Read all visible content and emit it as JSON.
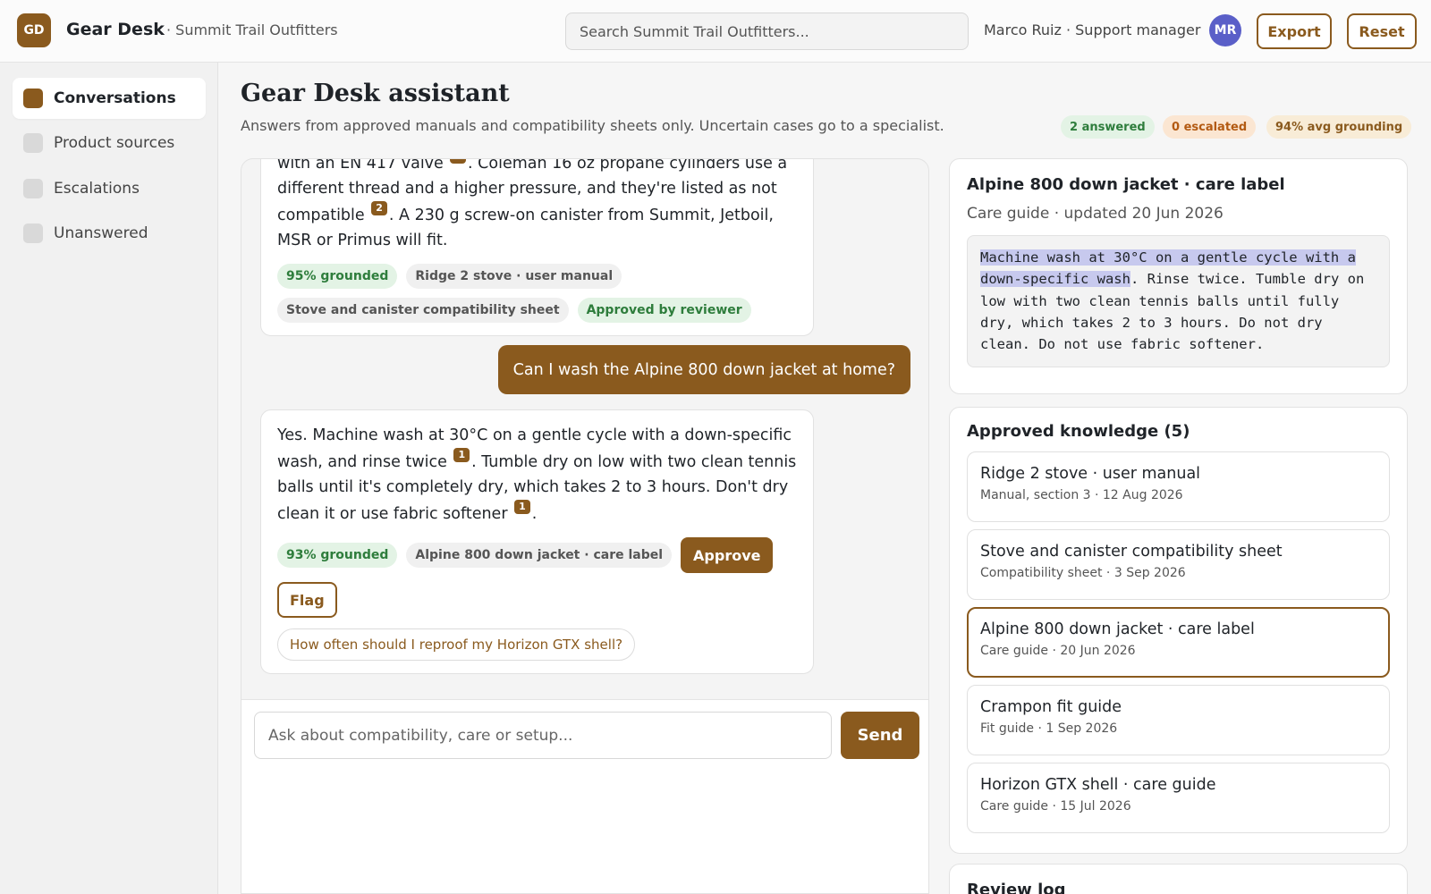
{
  "app": {
    "logo": "GD",
    "name": "Gear Desk",
    "org": "· Summit Trail Outfitters"
  },
  "topbar": {
    "search_placeholder": "Search Summit Trail Outfitters...",
    "user": "Marco Ruiz · Support manager",
    "avatar": "MR",
    "export_label": "Export",
    "reset_label": "Reset"
  },
  "sidebar": {
    "items": [
      {
        "label": "Conversations",
        "active": true
      },
      {
        "label": "Product sources"
      },
      {
        "label": "Escalations"
      },
      {
        "label": "Unanswered"
      }
    ]
  },
  "header": {
    "title": "Gear Desk assistant",
    "subtitle": "Answers from approved manuals and compatibility sheets only. Uncertain cases go to a specialist.",
    "badges": {
      "answered": "2 answered",
      "escalated": "0 escalated",
      "grounding": "94% avg grounding"
    }
  },
  "chat": {
    "prev_answer": {
      "line0": "with an EN 417 valve",
      "line1": ". Coleman 16 oz propane cylinders use a different thread and a higher pressure, and they're listed as not compatible",
      "cite_a": "1",
      "cite_b": "2",
      "line2": ". A 230 g screw-on canister from Summit, Jetboil, MSR or Primus will fit.",
      "grounded": "95% grounded",
      "source1": "Ridge 2 stove · user manual",
      "source2": "Stove and canister compatibility sheet",
      "approved": "Approved by reviewer"
    },
    "user_question": "Can I wash the Alpine 800 down jacket at home?",
    "answer": {
      "part1": "Yes. Machine wash at 30°C on a gentle cycle with a down-specific wash, and rinse twice",
      "cite1": "1",
      "part2": ". Tumble dry on low with two clean tennis balls until it's completely dry, which takes 2 to 3 hours. Don't dry clean it or use fabric softener",
      "cite2": "1",
      "part3": ".",
      "grounded": "93% grounded",
      "source": "Alpine 800 down jacket · care label",
      "approve_label": "Approve",
      "flag_label": "Flag",
      "suggestion": "How often should I reproof my Horizon GTX shell?"
    },
    "composer": {
      "placeholder": "Ask about compatibility, care or setup...",
      "send_label": "Send"
    }
  },
  "source_view": {
    "title": "Alpine 800 down jacket · care label",
    "meta": "Care guide · updated 20 Jun 2026",
    "highlight": "Machine wash at 30°C on a gentle cycle with a down-specific wash",
    "rest": ". Rinse twice. Tumble dry on low with two clean tennis balls until fully dry, which takes 2 to 3 hours. Do not dry clean. Do not use fabric softener."
  },
  "knowledge": {
    "title": "Approved knowledge (5)",
    "items": [
      {
        "name": "Ridge 2 stove · user manual",
        "meta": "Manual, section 3 · 12 Aug 2026"
      },
      {
        "name": "Stove and canister compatibility sheet",
        "meta": "Compatibility sheet · 3 Sep 2026"
      },
      {
        "name": "Alpine 800 down jacket · care label",
        "meta": "Care guide · 20 Jun 2026",
        "selected": true
      },
      {
        "name": "Crampon fit guide",
        "meta": "Fit guide · 1 Sep 2026"
      },
      {
        "name": "Horizon GTX shell · care guide",
        "meta": "Care guide · 15 Jul 2026"
      }
    ]
  },
  "review_log": {
    "title": "Review log"
  },
  "colors": {
    "accent": "#8a5a1e",
    "avatar": "#5a5fc8",
    "highlight": "#c7c9ee",
    "grounded": "#2e7d3c",
    "escalated": "#b35a12"
  }
}
